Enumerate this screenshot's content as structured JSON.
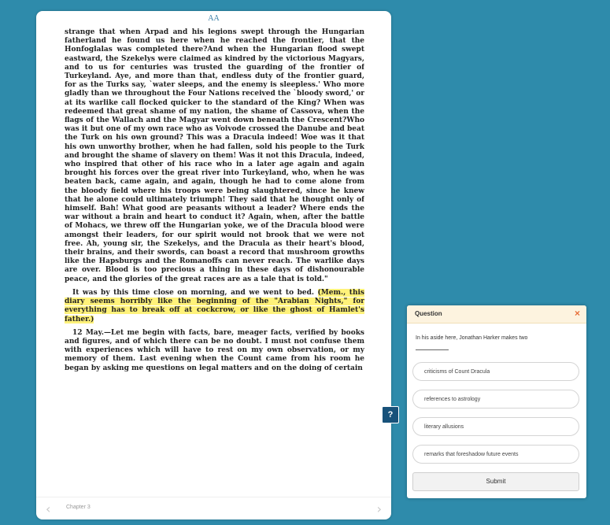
{
  "reader": {
    "font_size_toggle": "AA",
    "paragraphs": [
      {
        "text": "strange that when Arpad and his legions swept through the Hungarian fatherland he found us here when he reached the frontier, that the Honfoglalas was completed there?And when the Hungarian flood swept eastward, the Szekelys were claimed as kindred by the victorious Magyars, and to us for centuries was trusted the guarding of the frontier of Turkeyland. Aye, and more than that, endless duty of the frontier guard, for as the Turks say, `water sleeps, and the enemy is sleepless.' Who more gladly than we throughout the Four Nations received the `bloody sword,' or at its warlike call flocked quicker to the standard of the King? When was redeemed that great shame of my nation, the shame of Cassova, when the flags of the Wallach and the Magyar went down beneath the Crescent?Who was it but one of my own race who as Voivode crossed the Danube and beat the Turk on his own ground? This was a Dracula indeed! Woe was it that his own unworthy brother, when he had fallen, sold his people to the Turk and brought the shame of slavery on them! Was it not this Dracula, indeed, who inspired that other of his race who in a later age again and again brought his forces over the great river into Turkeyland, who, when he was beaten back, came again, and again, though he had to come alone from the bloody field where his troops were being slaughtered, since he knew that he alone could ultimately triumph! They said that he thought only of himself. Bah! What good are peasants without a leader? Where ends the war without a brain and heart to conduct it? Again, when, after the battle of Mohacs, we threw off the Hungarian yoke, we of the Dracula blood were amongst their leaders, for our spirit would not brook that we were not free. Ah, young sir, the Szekelys, and the Dracula as their heart's blood, their brains, and their swords, can boast a record that mushroom growths like the Hapsburgs and the Romanoffs can never reach. The warlike days are over. Blood is too precious a thing in these days of dishonourable peace, and the glories of the great races are as a tale that is told.\""
      },
      {
        "text": "It was by this time close on morning, and we went to bed. ",
        "highlight": "(Mem., this diary seems horribly like the beginning of the \"Arabian Nights,\" for everything has to break off at cockcrow, or like the ghost of Hamlet's father.)"
      },
      {
        "text": "12 May.—Let me begin with facts, bare, meager facts, verified by books and figures, and of which there can be no doubt. I must not confuse them with experiences which will have to rest on my own observation, or my memory of them. Last evening when the Count came from his room he began by asking me questions on legal matters and on the doing of certain"
      }
    ],
    "chapter_label": "Chapter 3",
    "prev_icon": "chevron-left-icon",
    "next_icon": "chevron-right-icon"
  },
  "help_button": {
    "label": "?",
    "icon": "question-mark-icon"
  },
  "question": {
    "title": "Question",
    "close_icon": "close-icon",
    "close_symbol": "×",
    "prompt": "In his aside here, Jonathan Harker makes two",
    "options": [
      "criticisms of Count Dracula",
      "references to astrology",
      "literary allusions",
      "remarks that foreshadow future events"
    ],
    "submit_label": "Submit"
  },
  "colors": {
    "background": "#2e8bab",
    "highlight": "#fff27a",
    "close_accent": "#e8703a",
    "help_button": "#18527a"
  }
}
